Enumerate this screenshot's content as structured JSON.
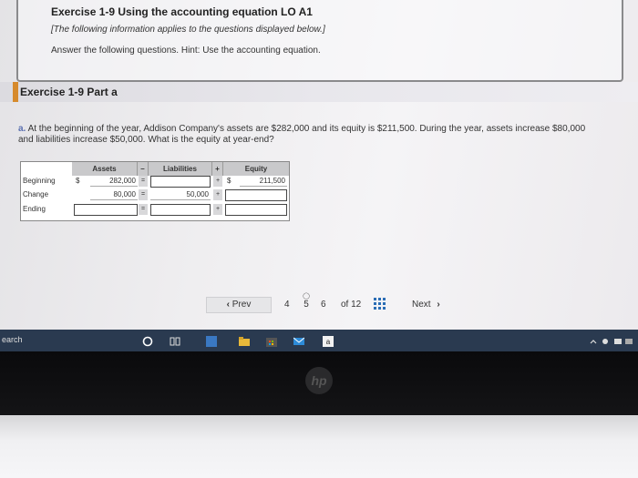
{
  "header": {
    "title": "Exercise 1-9 Using the accounting equation LO A1",
    "subtitle": "[The following information applies to the questions displayed below.]",
    "answer_prompt": "Answer the following questions. Hint: Use the accounting equation."
  },
  "part": {
    "title": "Exercise 1-9 Part a"
  },
  "question": {
    "label": "a.",
    "text": "At the beginning of the year, Addison Company's assets are $282,000 and its equity is $211,500. During the year, assets increase $80,000 and liabilities increase $50,000. What is the equity at year-end?"
  },
  "table": {
    "headers": {
      "assets": "Assets",
      "minus": "–",
      "liabilities": "Liabilities",
      "plus": "+",
      "equity": "Equity"
    },
    "rows": [
      {
        "label": "Beginning",
        "asset_dollar": "$",
        "assets": "282,000",
        "eq": "=",
        "liabilities": "",
        "plus": "+",
        "equity_dollar": "$",
        "equity": "211,500"
      },
      {
        "label": "Change",
        "asset_dollar": "",
        "assets": "80,000",
        "eq": "=",
        "liabilities": "50,000",
        "plus": "+",
        "equity_dollar": "",
        "equity": ""
      },
      {
        "label": "Ending",
        "asset_dollar": "",
        "assets": "",
        "eq": "=",
        "liabilities": "",
        "plus": "+",
        "equity_dollar": "",
        "equity": ""
      }
    ]
  },
  "pager": {
    "prev": "Prev",
    "pages": [
      "4",
      "5",
      "6"
    ],
    "current": "5",
    "of_label": "of 12",
    "next": "Next"
  },
  "taskbar": {
    "search": "earch"
  },
  "colors": {
    "accent": "#d68a2c",
    "taskbar": "#2a3a50"
  }
}
